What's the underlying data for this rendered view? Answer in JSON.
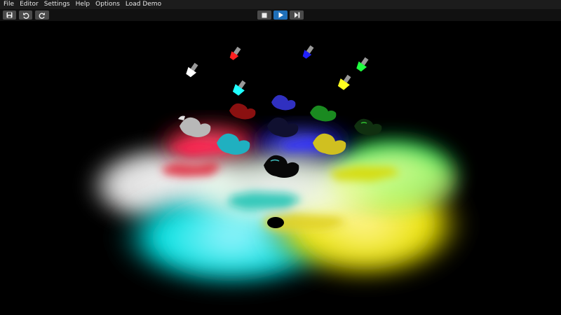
{
  "menu": {
    "items": [
      "File",
      "Editor",
      "Settings",
      "Help",
      "Options",
      "Load Demo"
    ]
  },
  "toolbar": {
    "left_buttons": [
      {
        "name": "save-button",
        "icon": "floppy-disk-icon"
      },
      {
        "name": "undo-button",
        "icon": "undo-icon"
      },
      {
        "name": "redo-button",
        "icon": "redo-icon"
      }
    ],
    "center_buttons": [
      {
        "name": "stop-button",
        "icon": "stop-icon"
      },
      {
        "name": "play-button",
        "icon": "play-icon",
        "active": true
      },
      {
        "name": "step-button",
        "icon": "step-forward-icon"
      }
    ],
    "accent": "#1f6fb8"
  },
  "scene": {
    "description_colors": {
      "lights": [
        "#ffffff",
        "#ff2020",
        "#2020ff",
        "#20ff20",
        "#20ffff",
        "#ffff20"
      ],
      "dragons": [
        "#c0c0c0",
        "#c02020",
        "#2020c0",
        "#20a020",
        "#20c0c0",
        "#202020",
        "#d0c020"
      ]
    }
  }
}
